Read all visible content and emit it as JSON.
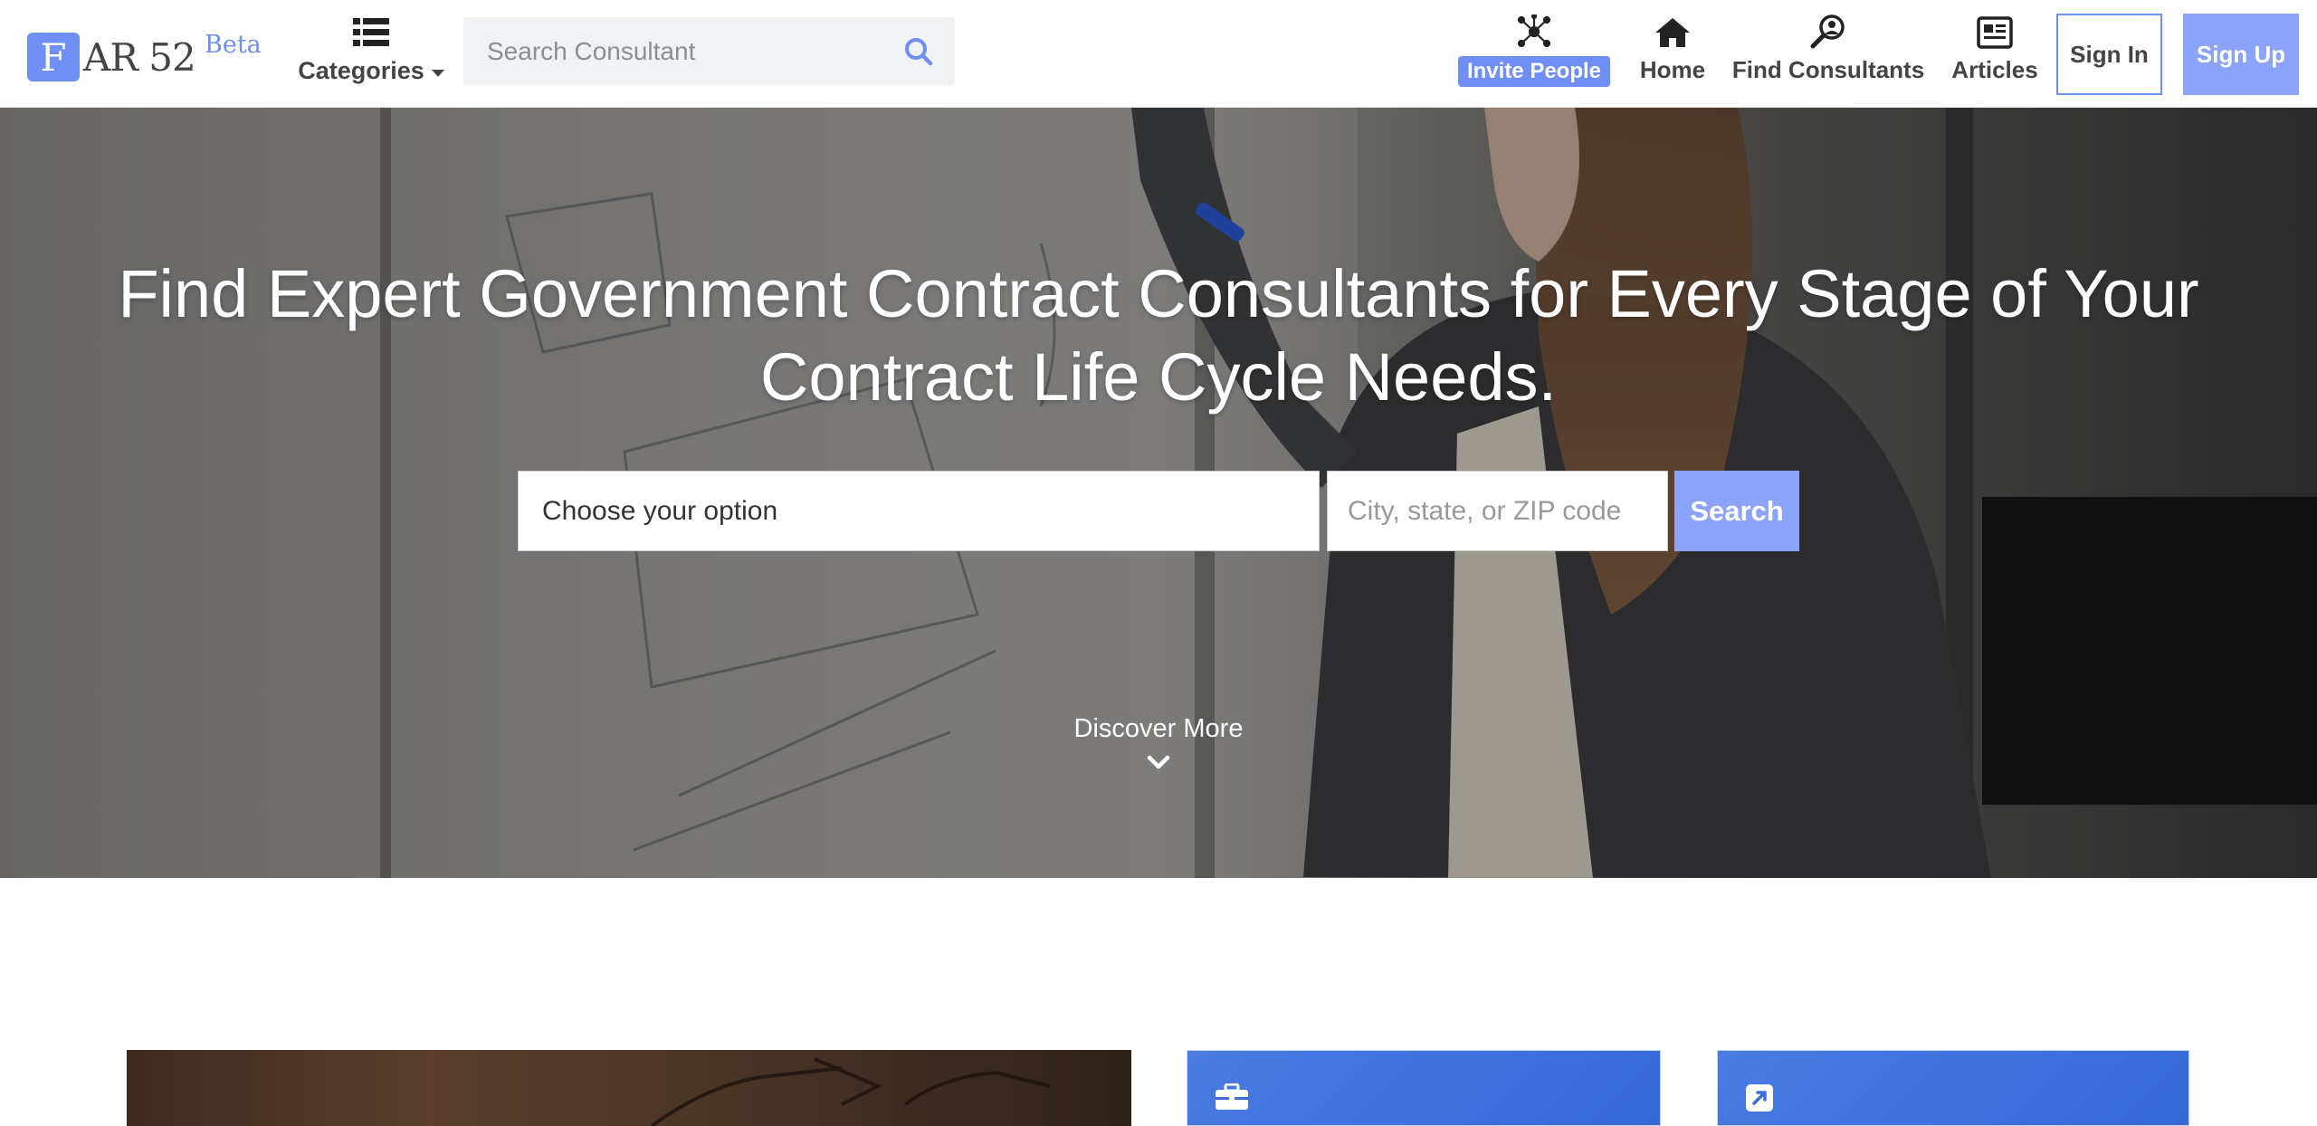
{
  "header": {
    "logo_letter": "F",
    "logo_text": "AR 52",
    "logo_badge": "Beta",
    "categories_label": "Categories",
    "search_placeholder": "Search Consultant",
    "nav": {
      "invite": "Invite People",
      "home": "Home",
      "find_consultants": "Find Consultants",
      "articles": "Articles"
    },
    "sign_in": "Sign In",
    "sign_up": "Sign Up"
  },
  "hero": {
    "title_line1": "Find Expert Government Contract Consultants for Every Stage of Your",
    "title_line2": "Contract Life Cycle Needs.",
    "select_value": "Choose your option",
    "location_placeholder": "City, state, or ZIP code",
    "search_button": "Search",
    "discover_more": "Discover More"
  },
  "colors": {
    "accent": "#6f8ff4",
    "button": "#8ba3f8",
    "card_blue": "#3a6ddb"
  },
  "icons": [
    "list-icon",
    "search-icon",
    "network-icon",
    "home-icon",
    "find-person-icon",
    "newspaper-icon",
    "chevron-down-icon",
    "briefcase-icon",
    "external-link-icon"
  ]
}
